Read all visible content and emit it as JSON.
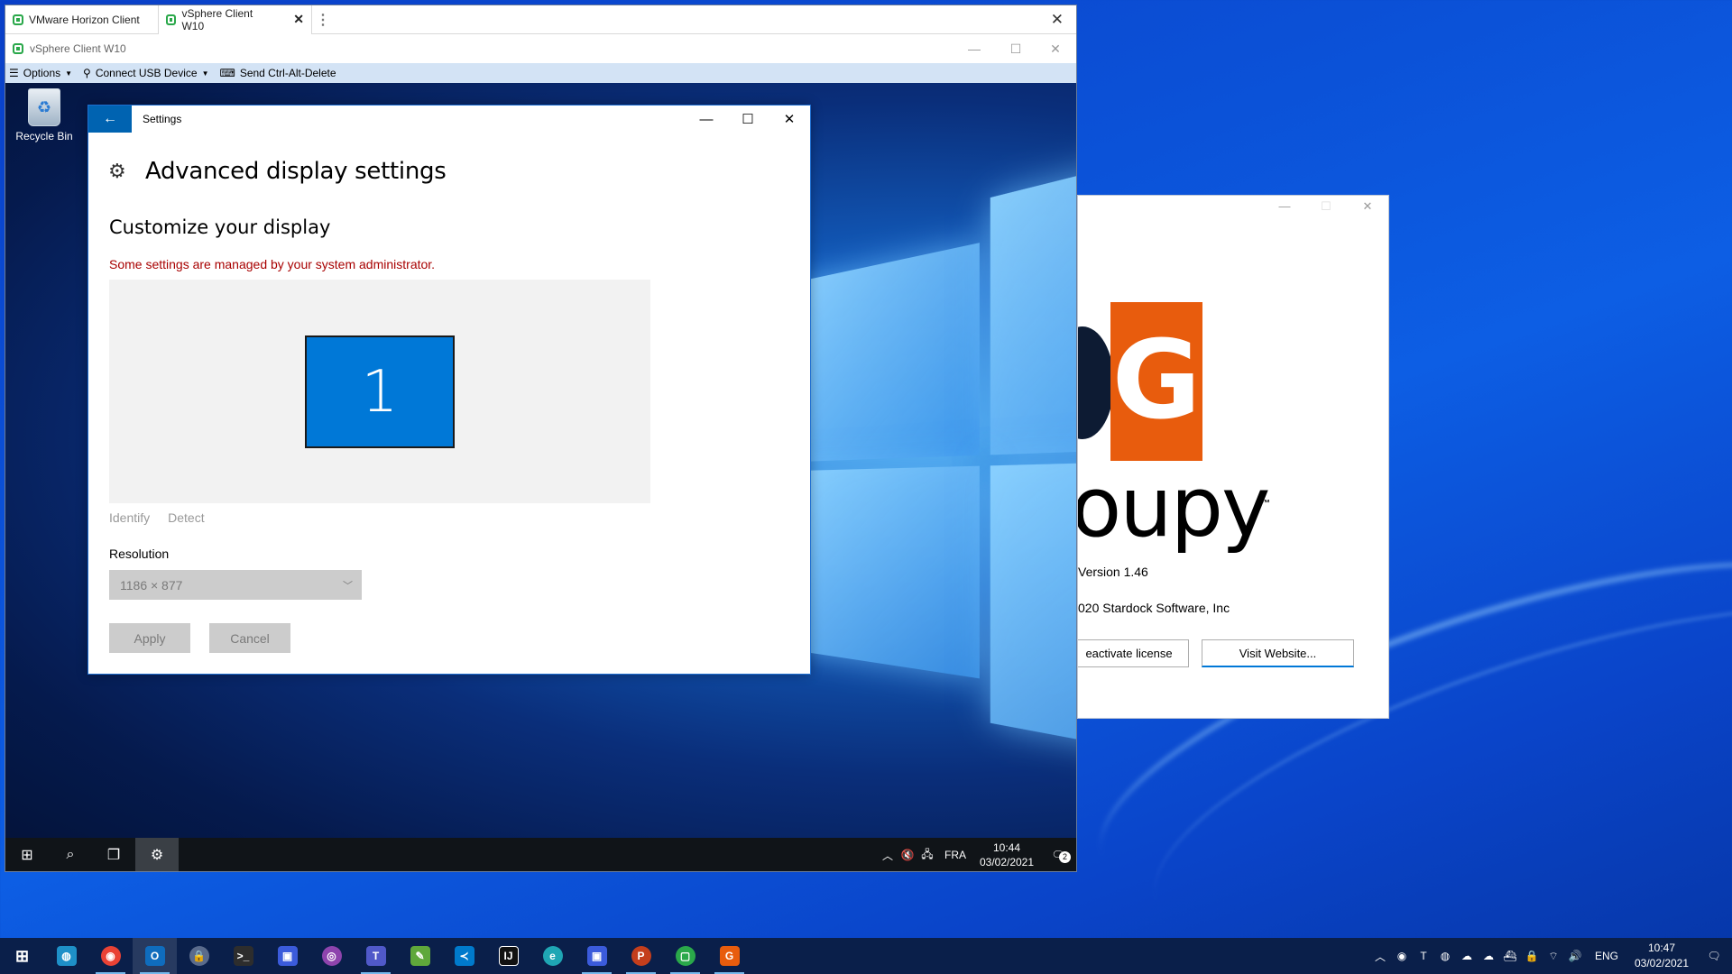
{
  "host": {
    "taskbar": {
      "apps": [
        "start",
        "globe",
        "chrome",
        "outlook",
        "vpn",
        "terminal",
        "save",
        "podcast",
        "teams",
        "notepad",
        "vscode",
        "intellij",
        "edge",
        "save2",
        "powerpoint",
        "horizon",
        "stardock"
      ],
      "lang": "ENG",
      "time": "10:47",
      "date": "03/02/2021"
    }
  },
  "horizon": {
    "tabs": [
      {
        "label": "VMware Horizon Client"
      },
      {
        "label": "vSphere Client W10"
      }
    ],
    "window_title": "vSphere Client W10",
    "menu": {
      "options": "Options",
      "usb": "Connect USB Device",
      "cad": "Send Ctrl-Alt-Delete"
    }
  },
  "guest": {
    "recycle_bin": "Recycle Bin",
    "settings": {
      "title": "Settings",
      "heading": "Advanced display settings",
      "subheading": "Customize your display",
      "warning": "Some settings are managed by your system administrator.",
      "monitor_number": "1",
      "identify": "Identify",
      "detect": "Detect",
      "resolution_label": "Resolution",
      "resolution_value": "1186 × 877",
      "apply": "Apply",
      "cancel": "Cancel"
    },
    "taskbar": {
      "lang": "FRA",
      "time": "10:44",
      "date": "03/02/2021",
      "notifications": "2"
    }
  },
  "about": {
    "logo_letter": "G",
    "brand": "oupy",
    "trademark": "™",
    "version": "Version 1.46",
    "copyright": "020 Stardock Software, Inc",
    "deactivate": "eactivate license",
    "visit": "Visit Website..."
  },
  "colors": {
    "accent": "#0078d7",
    "warning": "#a80000",
    "brand_orange": "#e85c0d",
    "menubar": "#d3e3f5"
  }
}
